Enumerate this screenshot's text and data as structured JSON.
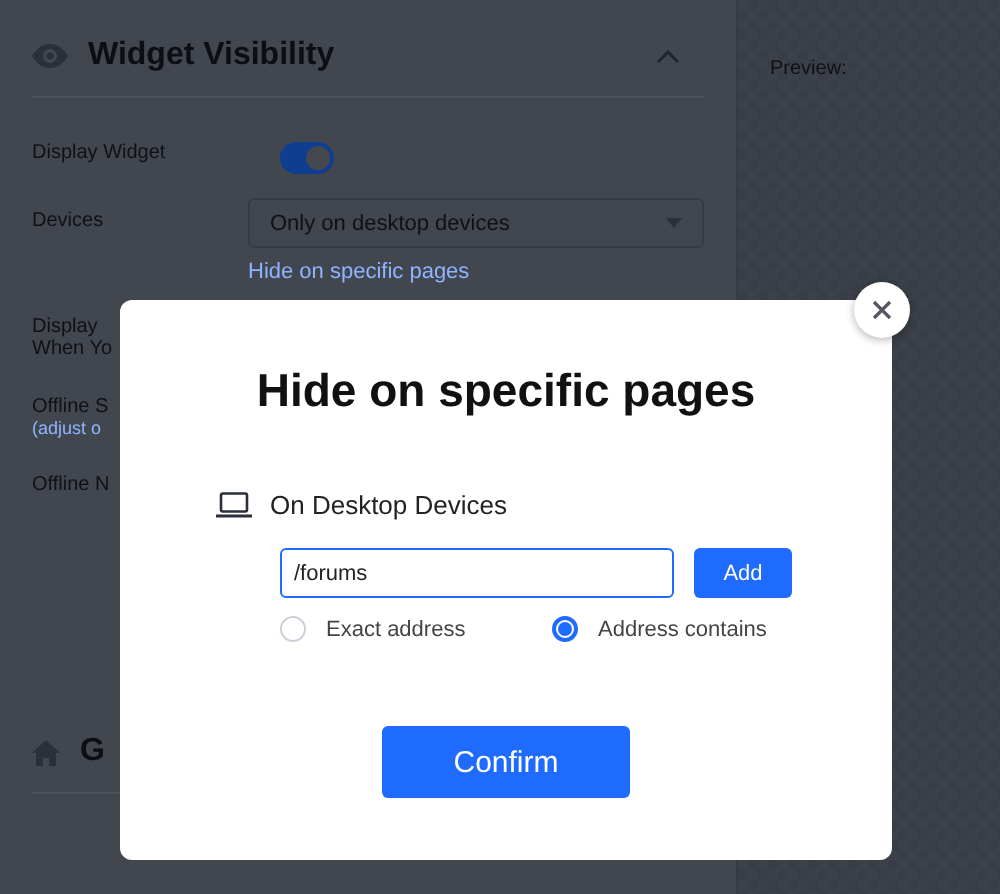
{
  "section": {
    "title": "Widget Visibility",
    "expanded": true
  },
  "preview": {
    "label": "Preview:"
  },
  "settings": [
    {
      "kind": "toggle",
      "label": "Display Widget",
      "on": true
    },
    {
      "kind": "select",
      "label": "Devices",
      "value": "Only on desktop devices",
      "link": "Hide on specific pages"
    },
    {
      "kind": "text",
      "label": "Display",
      "label_2": "When Yo"
    },
    {
      "kind": "text",
      "label": "Offline S",
      "note": "(adjust o"
    },
    {
      "kind": "text",
      "label": "Offline N"
    }
  ],
  "next_section": {
    "title": "G"
  },
  "dialog": {
    "title": "Hide on specific pages",
    "device": "On Desktop Devices",
    "address": "/forums",
    "add_button": "Add",
    "options": [
      {
        "label": "Exact address",
        "selected": false
      },
      {
        "label": "Address contains",
        "selected": true
      }
    ],
    "confirm": "Confirm"
  }
}
